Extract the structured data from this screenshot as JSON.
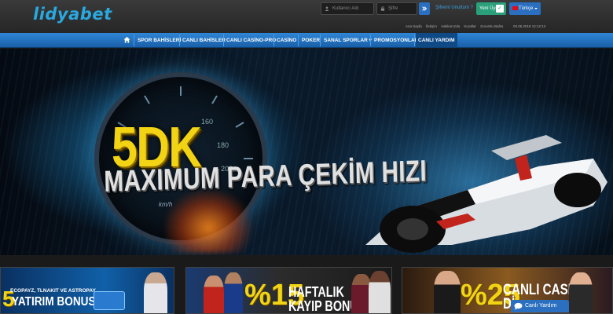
{
  "header": {
    "logo": "lidyabet",
    "username_placeholder": "Kullanıcı Adı",
    "password_placeholder": "Şifre",
    "forgot_label": "Şifremi Unuttum ?",
    "register_label": "Yeni Üye",
    "language_label": "Türkçe",
    "top_links": [
      "Ana Sayfa",
      "İletişim",
      "Hakkımızda",
      "Kurallar",
      "Sorumlu Bahis"
    ],
    "clock": "03.05.2018 12:12:12"
  },
  "nav": {
    "items": [
      "SPOR BAHİSLERİ",
      "CANLI BAHİSLER",
      "CANLI CASİNO-PRO",
      "CASİNO",
      "POKER",
      "SANAL SPORLAR",
      "PROMOSYONLAR",
      "CANLI YARDIM"
    ],
    "active_index": 7
  },
  "hero": {
    "headline_number": "5DK",
    "headline_text": "MAXIMUM PARA ÇEKİM HIZI",
    "speed_unit": "km/h",
    "gauge_ticks": [
      "160",
      "180",
      "200"
    ]
  },
  "promos": [
    {
      "number": "5",
      "subtitle": "ECOPAYZ, TLNAKIT VE ASTROPAY",
      "title": "YATIRIM BONUSU"
    },
    {
      "number": "%15",
      "title_line1": "HAFTALIK",
      "title_line2": "KAYIP BONUSU"
    },
    {
      "number": "%25",
      "title_line1": "CANLI CASINO",
      "title_line2": "Dİ"
    }
  ],
  "chat": {
    "label": "Canlı Yardım"
  },
  "colors": {
    "accent": "#2aa8e0",
    "nav_blue": "#1f6fc0",
    "register_green": "#2aa07a",
    "headline_yellow": "#f2d414"
  }
}
